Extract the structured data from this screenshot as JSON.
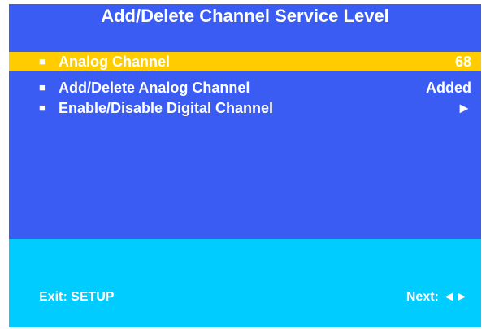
{
  "title": "Add/Delete Channel Service Level",
  "menu": {
    "items": [
      {
        "bullet": "■",
        "label": "Analog Channel",
        "value": "68",
        "selected": true
      },
      {
        "bullet": "■",
        "label": "Add/Delete Analog Channel",
        "value": "Added",
        "selected": false
      },
      {
        "bullet": "■",
        "label": "Enable/Disable Digital Channel",
        "value": "►",
        "selected": false
      }
    ]
  },
  "footer": {
    "exit": "Exit: SETUP",
    "next": "Next: ◄►"
  },
  "colors": {
    "menu_background": "#3a5cf2",
    "highlight": "#ffcc00",
    "footer_background": "#00ccff",
    "text": "#ffffff"
  }
}
